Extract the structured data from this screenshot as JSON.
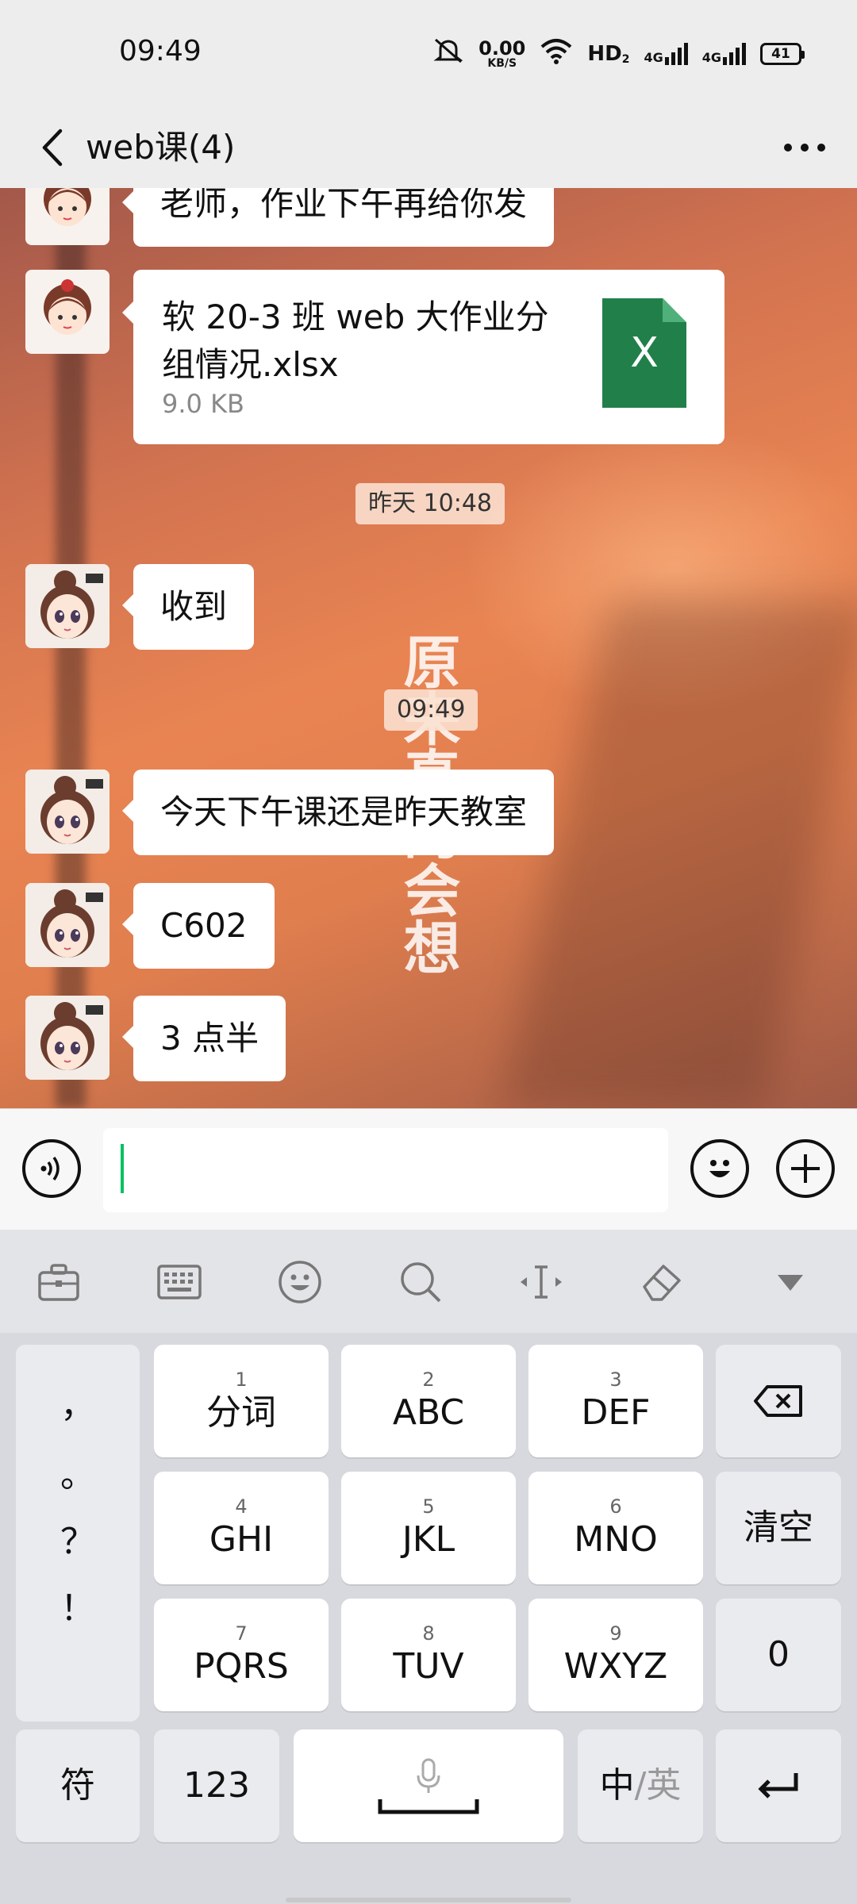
{
  "status_bar": {
    "time": "09:49",
    "net_speed_value": "0.00",
    "net_speed_unit": "KB/S",
    "hd_label": "HD",
    "hd_sub": "2",
    "signal1_label": "4G",
    "signal2_label": "4G",
    "battery": "41"
  },
  "header": {
    "title": "web课(4)",
    "more_label": "···"
  },
  "messages": [
    {
      "type": "text",
      "text": "老师，作业下午再给你发"
    },
    {
      "type": "file",
      "file_name": "软 20-3 班 web 大作业分\n组情况.xlsx",
      "file_size": "9.0 KB",
      "file_icon_letter": "X"
    },
    {
      "type": "time",
      "text": "昨天 10:48"
    },
    {
      "type": "text",
      "text": "收到"
    },
    {
      "type": "time",
      "text": "09:49"
    },
    {
      "type": "text",
      "text": "今天下午课还是昨天教室"
    },
    {
      "type": "text",
      "text": "C602"
    },
    {
      "type": "text",
      "text": "3 点半"
    }
  ],
  "wallpaper_text": "原来真的会想",
  "keyboard": {
    "punctuation": [
      "，",
      "。",
      "？",
      "！"
    ],
    "row1": [
      {
        "num": "1",
        "label": "分词"
      },
      {
        "num": "2",
        "label": "ABC"
      },
      {
        "num": "3",
        "label": "DEF"
      }
    ],
    "row2": [
      {
        "num": "4",
        "label": "GHI"
      },
      {
        "num": "5",
        "label": "JKL"
      },
      {
        "num": "6",
        "label": "MNO"
      }
    ],
    "row3": [
      {
        "num": "7",
        "label": "PQRS"
      },
      {
        "num": "8",
        "label": "TUV"
      },
      {
        "num": "9",
        "label": "WXYZ"
      }
    ],
    "clear_label": "清空",
    "zero_label": "0",
    "symbol_label": "符",
    "num_mode_label": "123",
    "lang_cn": "中",
    "lang_sep": "/",
    "lang_en": "英"
  },
  "icons": {
    "back": "chevron-left-icon",
    "more": "more-dots-icon",
    "voice": "voice-icon",
    "emoji": "emoji-icon",
    "plus": "plus-icon",
    "toolbar": [
      "toolbox-icon",
      "keyboard-icon",
      "emoji-icon",
      "search-icon",
      "cursor-icon",
      "eraser-icon",
      "collapse-icon"
    ]
  },
  "colors": {
    "excel_green": "#21804a",
    "accent_green": "#07c160"
  }
}
